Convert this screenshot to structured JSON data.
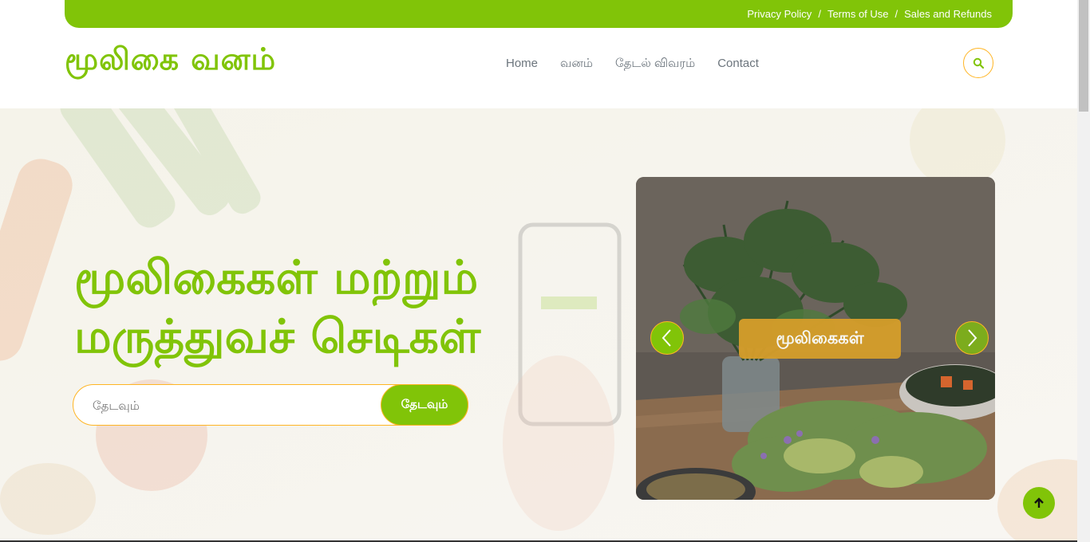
{
  "topbar": {
    "links": [
      "Privacy Policy",
      "Terms of Use",
      "Sales and Refunds"
    ],
    "separator": "/"
  },
  "header": {
    "logo": "மூலிகை வனம்",
    "nav": [
      "Home",
      "வனம்",
      "தேடல் விவரம்",
      "Contact"
    ]
  },
  "hero": {
    "title_line1": "மூலிகைகள் மற்றும்",
    "title_line2": "மருத்துவச் செடிகள்",
    "search_placeholder": "தேடவும்",
    "search_button": "தேடவும்"
  },
  "carousel": {
    "caption": "மூலிகைகள்"
  },
  "colors": {
    "primary": "#81c408",
    "secondary": "#ffb524",
    "caption_bg": "#d69e2a"
  },
  "icons": [
    "search-icon",
    "chevron-left-icon",
    "chevron-right-icon",
    "arrow-up-icon"
  ]
}
